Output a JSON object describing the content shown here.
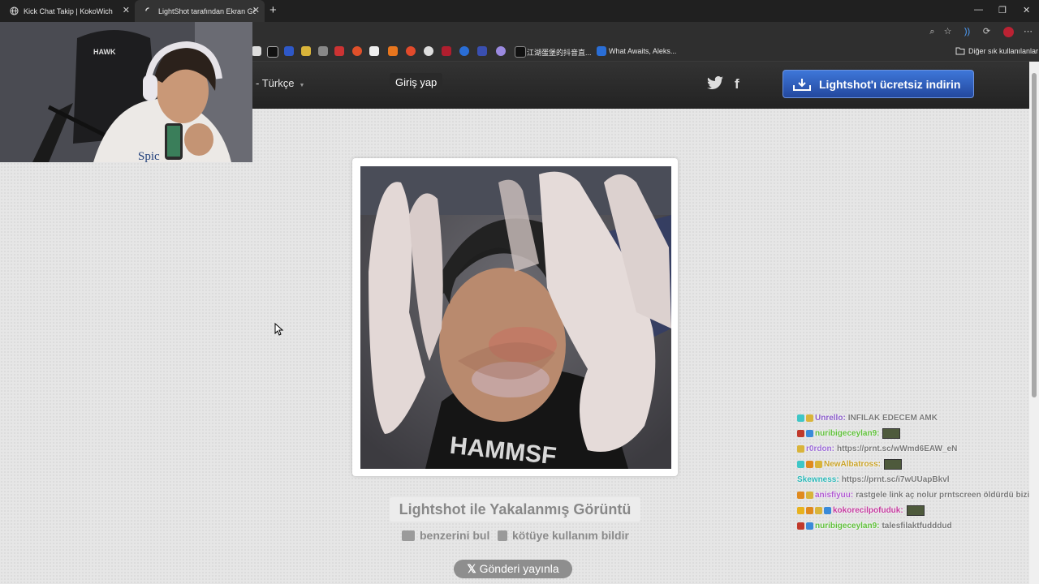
{
  "tabs": [
    {
      "title": "Kick Chat Takip | KokoWich",
      "icon": "globe-icon"
    },
    {
      "title": "LightShot tarafından Ekran Görüntüsü",
      "icon": "loading-icon"
    }
  ],
  "bookmarks": {
    "item_label_1": "江湖蛋堡的抖音直...",
    "item_label_2": "What Awaits, Aleks...",
    "other_folder": "Diğer sık kullanılanlar"
  },
  "header": {
    "language": "- Türkçe",
    "login": "Giriş yap",
    "download_button": "Lightshot'ı ücretsiz indirin"
  },
  "main": {
    "caption": "Lightshot ile Yakalanmış Görüntü",
    "find_similar": "benzerini bul",
    "report_abuse": "kötüye kullanım bildir",
    "post_button": "Gönderi yayınla"
  },
  "chat": [
    {
      "user": "Unrello:",
      "message": "INFILAK EDECEM AMK",
      "user_color": "#8a5cc9",
      "badges": [
        "#3fc6c6",
        "#d9b43a"
      ],
      "emote": false
    },
    {
      "user": "nuribigeceylan9:",
      "message": "",
      "user_color": "#5fbf3a",
      "badges": [
        "#c0392b",
        "#3a8ad9"
      ],
      "emote": true
    },
    {
      "user": "r0rdon:",
      "message": "https://prnt.sc/wWmd6EAW_eN",
      "user_color": "#9b6bd6",
      "badges": [
        "#d9b43a"
      ],
      "emote": false
    },
    {
      "user": "NewAlbatross:",
      "message": "",
      "user_color": "#c9a227",
      "badges": [
        "#3fc6c6",
        "#e08a1e",
        "#d9b43a"
      ],
      "emote": true
    },
    {
      "user": "Skewness:",
      "message": "https://prnt.sc/i7wUUapBkvl",
      "user_color": "#2bb7b7",
      "badges": [],
      "emote": false
    },
    {
      "user": "anisfiyuu:",
      "message": "rastgele link aç nolur prntscreen öldürdü bizi",
      "user_color": "#b05ad1",
      "badges": [
        "#e08a1e",
        "#d9b43a"
      ],
      "emote": false
    },
    {
      "user": "kokorecilpofuduk:",
      "message": "",
      "user_color": "#c43a9e",
      "badges": [
        "#e8b21e",
        "#e08a1e",
        "#d9b43a",
        "#3a8ad9"
      ],
      "emote": true
    },
    {
      "user": "nuribigeceylan9:",
      "message": "talesfilaktfudddud",
      "user_color": "#5fbf3a",
      "badges": [
        "#c0392b",
        "#3a8ad9"
      ],
      "emote": false
    }
  ]
}
